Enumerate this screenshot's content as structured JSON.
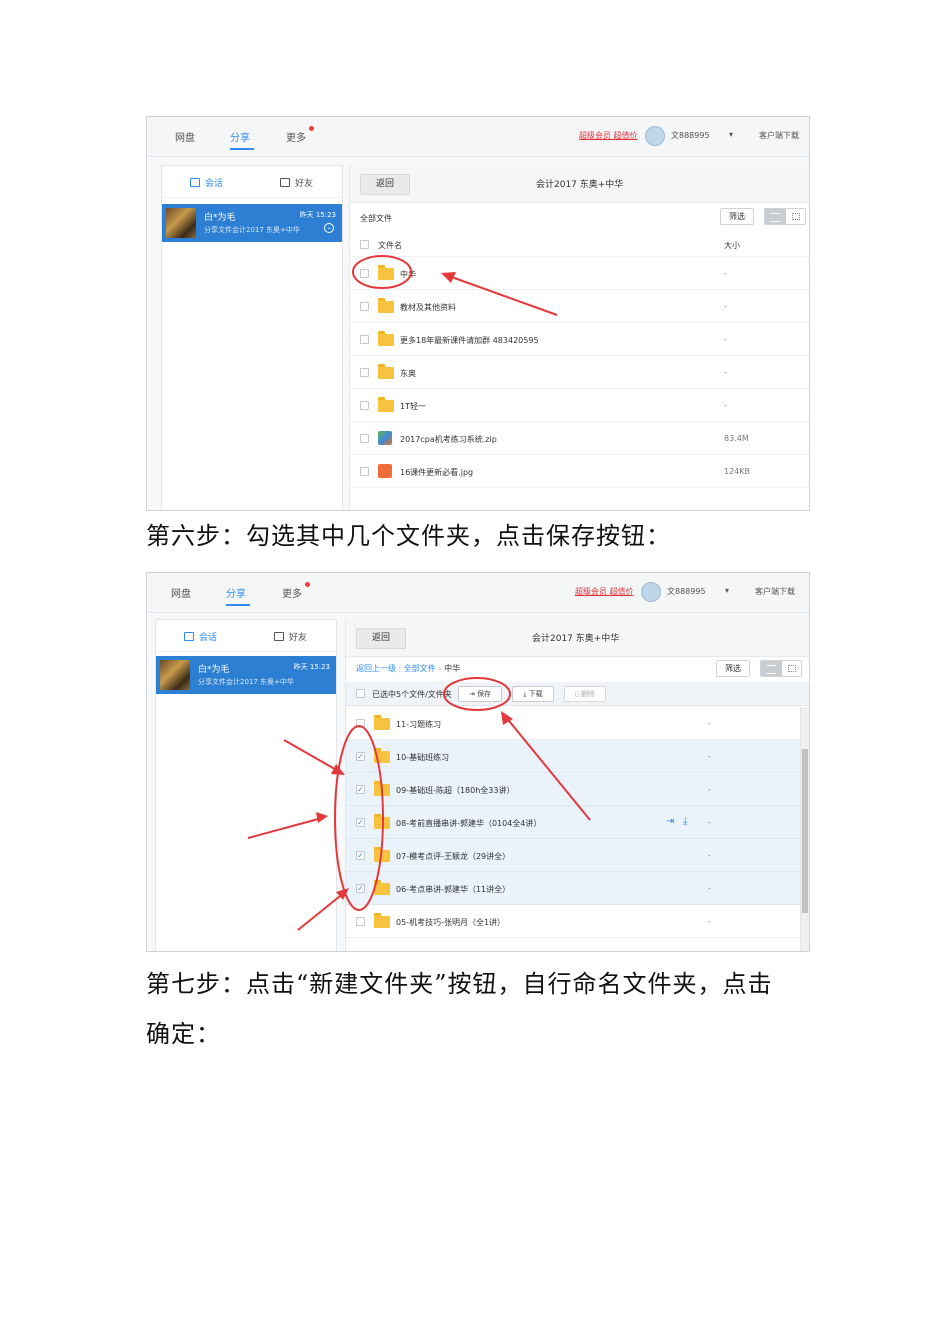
{
  "screenshot1": {
    "nav": {
      "tab_disk": "网盘",
      "tab_share": "分享",
      "tab_more": "更多"
    },
    "topright": {
      "vip": "超级会员 超值价",
      "username": "文888995",
      "download_client": "客户端下载"
    },
    "sidebar": {
      "tab_chat": "会话",
      "tab_friends": "好友"
    },
    "conversation": {
      "name": "白*为毛",
      "time": "昨天 15:23",
      "subtitle": "分享文件会计2017 东奥+中华"
    },
    "main": {
      "back_label": "返回",
      "title": "会计2017 东奥+中华",
      "all_files": "全部文件",
      "filter_label": "筛选",
      "col_name": "文件名",
      "col_size": "大小"
    },
    "files": [
      {
        "name": "中华",
        "size": "-",
        "type": "folder"
      },
      {
        "name": "教材及其他资料",
        "size": "-",
        "type": "folder"
      },
      {
        "name": "更多18年最新课件请加群 483420595",
        "size": "-",
        "type": "folder"
      },
      {
        "name": "东奥",
        "size": "-",
        "type": "folder"
      },
      {
        "name": "1T轻一",
        "size": "-",
        "type": "folder"
      },
      {
        "name": "2017cpa机考练习系统.zip",
        "size": "83.4M",
        "type": "zip"
      },
      {
        "name": "16课件更新必看.jpg",
        "size": "124KB",
        "type": "image"
      }
    ]
  },
  "caption1": "第六步：勾选其中几个文件夹，点击保存按钮：",
  "screenshot2": {
    "nav": {
      "tab_disk": "网盘",
      "tab_share": "分享",
      "tab_more": "更多"
    },
    "topright": {
      "vip": "超级会员 超值价",
      "username": "文888995",
      "download_client": "客户端下载"
    },
    "sidebar": {
      "tab_chat": "会话",
      "tab_friends": "好友"
    },
    "conversation": {
      "name": "白*为毛",
      "time": "昨天 15:23",
      "subtitle": "分享文件会计2017 东奥+中华"
    },
    "main": {
      "back_label": "返回",
      "title": "会计2017 东奥+中华",
      "crumb_up": "返回上一级",
      "crumb_all": "全部文件",
      "crumb_current": "中华",
      "filter_label": "筛选",
      "selected_text": "已选中5个文件/文件夹",
      "save_label": "保存",
      "download_label": "下载",
      "delete_label": "删除"
    },
    "files": [
      {
        "name": "11-习题练习",
        "size": "-",
        "checked": false
      },
      {
        "name": "10-基础班练习",
        "size": "-",
        "checked": true
      },
      {
        "name": "09-基础班-陈超（180h全33讲）",
        "size": "-",
        "checked": true
      },
      {
        "name": "08-考前直播串讲-郭建华（0104全4讲）",
        "size": "-",
        "checked": true
      },
      {
        "name": "07-模考点评-王颖龙（29讲全）",
        "size": "-",
        "checked": true
      },
      {
        "name": "06-考点串讲-郭建华（11讲全）",
        "size": "-",
        "checked": true
      },
      {
        "name": "05-机考技巧-张明月（全1讲）",
        "size": "-",
        "checked": false
      }
    ]
  },
  "caption2_line1": "第七步：点击“新建文件夹”按钮，自行命名文件夹，点击",
  "caption2_line2": "确定：",
  "colors": {
    "accent": "#2d8cf0",
    "selected_conv": "#2d7fd3",
    "annotation": "#e5383b",
    "folder": "#f7c33e"
  }
}
